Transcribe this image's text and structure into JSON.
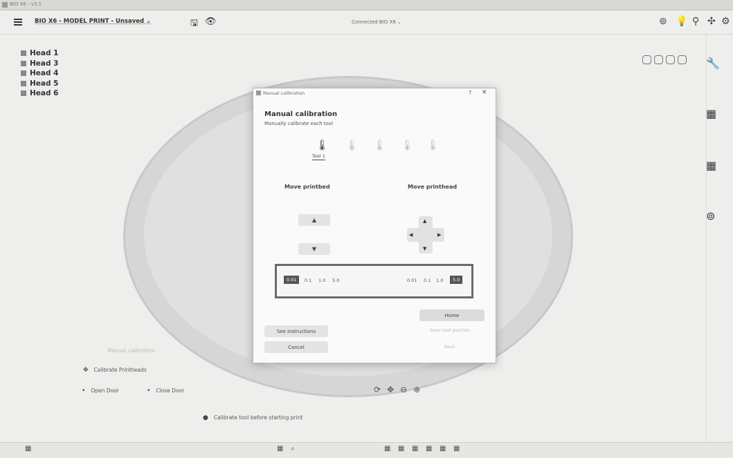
{
  "system": {
    "title": "BIO X6 - v3.1"
  },
  "header": {
    "project": "BIO X6 - MODEL PRINT - Unsaved ⌄",
    "status": "Connected BIO X6 ⌄"
  },
  "heads": [
    "Head 1",
    "Head 3",
    "Head 4",
    "Head 5",
    "Head 6"
  ],
  "controls": {
    "manual_label": "Manual calibration",
    "calibrate": "Calibrate Printheads",
    "open_door": "Open Door",
    "close_door": "Close Door",
    "calibrate_before": "Calibrate tool before starting print"
  },
  "dialog": {
    "title": "Manual calibration",
    "help": "?",
    "close": "✕",
    "heading": "Manual calibration",
    "subtitle": "Manually calibrate each tool",
    "active_tool": "Tool 1",
    "move_bed": "Move printbed",
    "move_head": "Move printhead",
    "up": "▲",
    "down": "▼",
    "left": "◀",
    "right": "▶",
    "steps_left": [
      "0.01",
      "0.1",
      "1.0",
      "5.0"
    ],
    "steps_right": [
      "0.01",
      "0.1",
      "1.0",
      "5.0"
    ],
    "home": "Home",
    "save_position": "Save tool position",
    "see_instructions": "See instructions",
    "cancel": "Cancel",
    "next": "Next"
  },
  "icons": {
    "camera": "⊚",
    "lightbulb": "💡",
    "location": "⚲",
    "fan": "✣",
    "gear": "⚙",
    "save": "🖫",
    "eye": "👁",
    "rotate": "⟳",
    "move": "✥",
    "zoom_in": "⊕",
    "zoom_out": "⊖",
    "syringe": "🔧",
    "grid": "▦",
    "search": "⌕"
  }
}
